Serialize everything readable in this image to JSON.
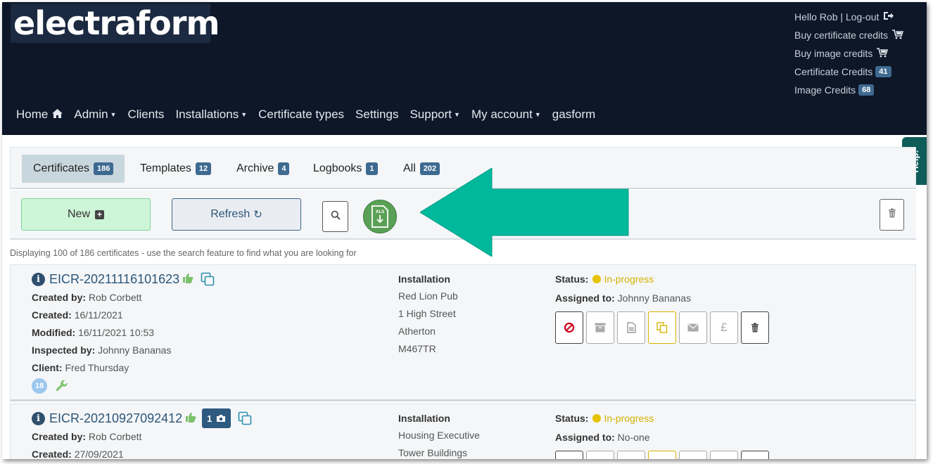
{
  "header": {
    "logo": "electraform",
    "account": {
      "greeting": "Hello Rob | Log-out",
      "buy_certificate_credits": "Buy certificate credits",
      "buy_image_credits": "Buy image credits",
      "certificate_credits_label": "Certificate Credits",
      "certificate_credits_count": "41",
      "image_credits_label": "Image Credits",
      "image_credits_count": "68"
    },
    "nav": [
      {
        "label": "Home",
        "icon": "home-icon"
      },
      {
        "label": "Admin",
        "dropdown": true
      },
      {
        "label": "Clients"
      },
      {
        "label": "Installations",
        "dropdown": true
      },
      {
        "label": "Certificate types"
      },
      {
        "label": "Settings"
      },
      {
        "label": "Support",
        "dropdown": true
      },
      {
        "label": "My account",
        "dropdown": true
      },
      {
        "label": "gasform"
      }
    ]
  },
  "help_tab": "Help!",
  "tabs": [
    {
      "label": "Certificates",
      "count": "186",
      "active": true
    },
    {
      "label": "Templates",
      "count": "12"
    },
    {
      "label": "Archive",
      "count": "4"
    },
    {
      "label": "Logbooks",
      "count": "1"
    },
    {
      "label": "All",
      "count": "202"
    }
  ],
  "toolbar": {
    "new_label": "New",
    "refresh_label": "Refresh",
    "xls_label": "XLS"
  },
  "info_text": "Displaying 100 of 186 certificates - use the search feature to find what you are looking for",
  "certificates": [
    {
      "id": "EICR-20211116101623",
      "created_by_label": "Created by:",
      "created_by": "Rob Corbett",
      "created_label": "Created:",
      "created": "16/11/2021",
      "modified_label": "Modified:",
      "modified": "16/11/2021 10:53",
      "inspected_by_label": "Inspected by:",
      "inspected_by": "Johnny Bananas",
      "client_label": "Client:",
      "client": "Fred Thursday",
      "count_circle": "18",
      "installation_label": "Installation",
      "installation_lines": [
        "Red Lion Pub",
        "1 High Street",
        "Atherton",
        "M467TR"
      ],
      "status_label": "Status:",
      "status": "In-progress",
      "assigned_label": "Assigned to:",
      "assigned_to": "Johnny Bananas"
    },
    {
      "id": "EICR-20210927092412",
      "photo_count": "1",
      "created_by_label": "Created by:",
      "created_by": "Rob Corbett",
      "created_label": "Created:",
      "created": "27/09/2021",
      "installation_label": "Installation",
      "installation_lines": [
        "Housing Executive",
        "Tower Buildings"
      ],
      "status_label": "Status:",
      "status": "In-progress",
      "assigned_label": "Assigned to:",
      "assigned_to": "No-one"
    }
  ],
  "colors": {
    "header_bg": "#0d1728",
    "badge": "#3e6a90",
    "status_in_progress": "#e6c200",
    "annotation_arrow": "#00b89c"
  }
}
